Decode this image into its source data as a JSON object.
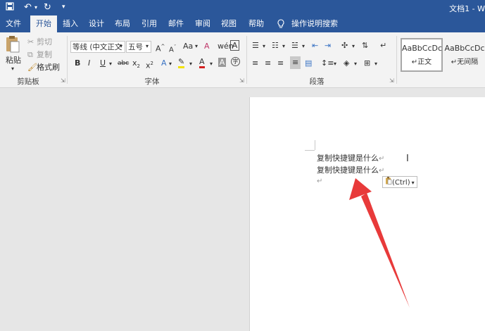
{
  "title_bar": {
    "doc_title": "文档1 - W"
  },
  "tabs": [
    {
      "label": "文件"
    },
    {
      "label": "开始"
    },
    {
      "label": "插入"
    },
    {
      "label": "设计"
    },
    {
      "label": "布局"
    },
    {
      "label": "引用"
    },
    {
      "label": "邮件"
    },
    {
      "label": "审阅"
    },
    {
      "label": "视图"
    },
    {
      "label": "帮助"
    }
  ],
  "active_tab": "开始",
  "tell_me": "操作说明搜索",
  "clipboard": {
    "paste_label": "粘贴",
    "cut_label": "剪切",
    "copy_label": "复制",
    "format_painter_label": "格式刷",
    "group_label": "剪贴板"
  },
  "font": {
    "font_name": "等线 (中文正文",
    "font_size": "五号",
    "change_case": "Aa",
    "group_label": "字体"
  },
  "paragraph": {
    "group_label": "段落"
  },
  "styles": {
    "items": [
      {
        "preview": "AaBbCcDc",
        "name": "正文"
      },
      {
        "preview": "AaBbCcDc",
        "name": "无间隔"
      }
    ]
  },
  "document": {
    "lines": [
      "复制快捷键是什么",
      "复制快捷键是什么"
    ],
    "paragraph_mark": "↵",
    "paste_options_label": "(Ctrl)"
  },
  "colors": {
    "title_bar": "#2b579a",
    "ribbon": "#f3f3f3",
    "annotation_arrow": "#e83a3a"
  }
}
